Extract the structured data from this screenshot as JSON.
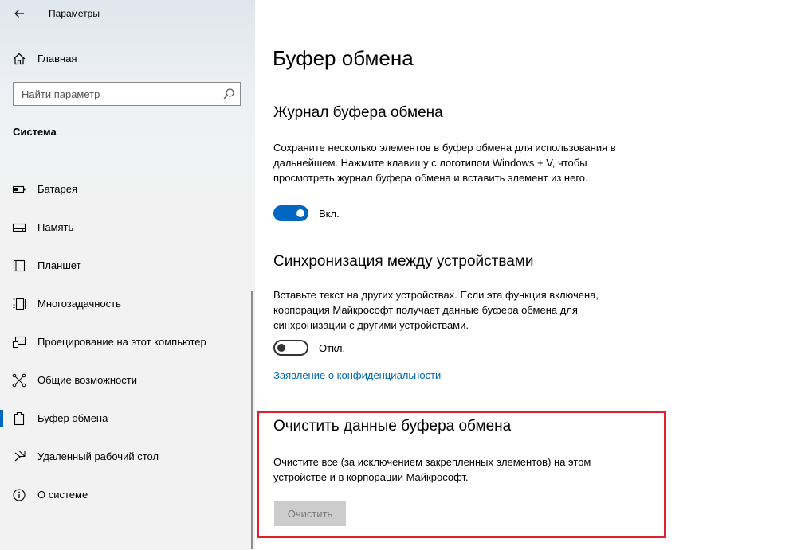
{
  "window": {
    "title": "Параметры"
  },
  "sidebar": {
    "home_label": "Главная",
    "search_placeholder": "Найти параметр",
    "section_label": "Система",
    "items": [
      {
        "label": "Батарея",
        "icon": "battery-icon"
      },
      {
        "label": "Память",
        "icon": "storage-icon"
      },
      {
        "label": "Планшет",
        "icon": "tablet-icon"
      },
      {
        "label": "Многозадачность",
        "icon": "multitasking-icon"
      },
      {
        "label": "Проецирование на этот компьютер",
        "icon": "projecting-icon"
      },
      {
        "label": "Общие возможности",
        "icon": "shared-experiences-icon"
      },
      {
        "label": "Буфер обмена",
        "icon": "clipboard-icon",
        "active": true
      },
      {
        "label": "Удаленный рабочий стол",
        "icon": "remote-desktop-icon"
      },
      {
        "label": "О системе",
        "icon": "info-icon"
      }
    ]
  },
  "main": {
    "title": "Буфер обмена",
    "history": {
      "heading": "Журнал буфера обмена",
      "description": "Сохраните несколько элементов в буфер обмена для использования в дальнейшем. Нажмите клавишу с логотипом Windows + V, чтобы просмотреть журнал буфера обмена и вставить элемент из него.",
      "toggle_state": "on",
      "toggle_label": "Вкл."
    },
    "sync": {
      "heading": "Синхронизация между устройствами",
      "description": "Вставьте текст на других устройствах. Если эта функция включена, корпорация Майкрософт получает данные буфера обмена для синхронизации с другими устройствами.",
      "toggle_state": "off",
      "toggle_label": "Откл.",
      "privacy_link": "Заявление о конфиденциальности"
    },
    "clear": {
      "heading": "Очистить данные буфера обмена",
      "description": "Очистите все (за исключением закрепленных элементов) на этом устройстве и в корпорации Майкрософт.",
      "button_label": "Очистить",
      "button_enabled": false
    }
  },
  "colors": {
    "accent": "#0067c0",
    "link": "#0067b8",
    "highlight": "#e0202a"
  }
}
